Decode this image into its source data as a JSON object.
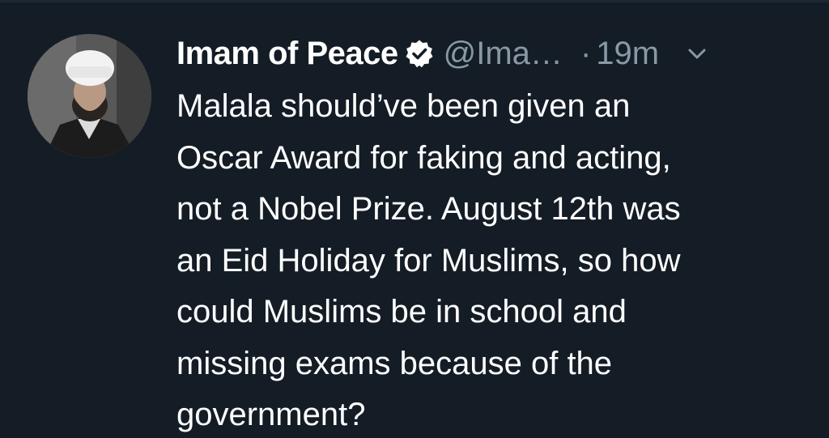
{
  "author": {
    "display_name": "Imam of Peace",
    "handle": "@Ima…",
    "separator": "·",
    "timestamp": "19m",
    "verified": true
  },
  "tweet": {
    "lines": [
      "Malala should’ve been given an",
      "Oscar Award for faking and acting,",
      "not a Nobel Prize. August 12th was",
      "an Eid Holiday for Muslims, so how",
      "could Muslims be in school and",
      "missing exams because of the",
      "government?"
    ]
  },
  "icons": {
    "verified": "verified-badge-icon",
    "menu": "chevron-down-icon"
  },
  "colors": {
    "background": "#141d26",
    "primary_text": "#ffffff",
    "secondary_text": "#8899a6"
  }
}
